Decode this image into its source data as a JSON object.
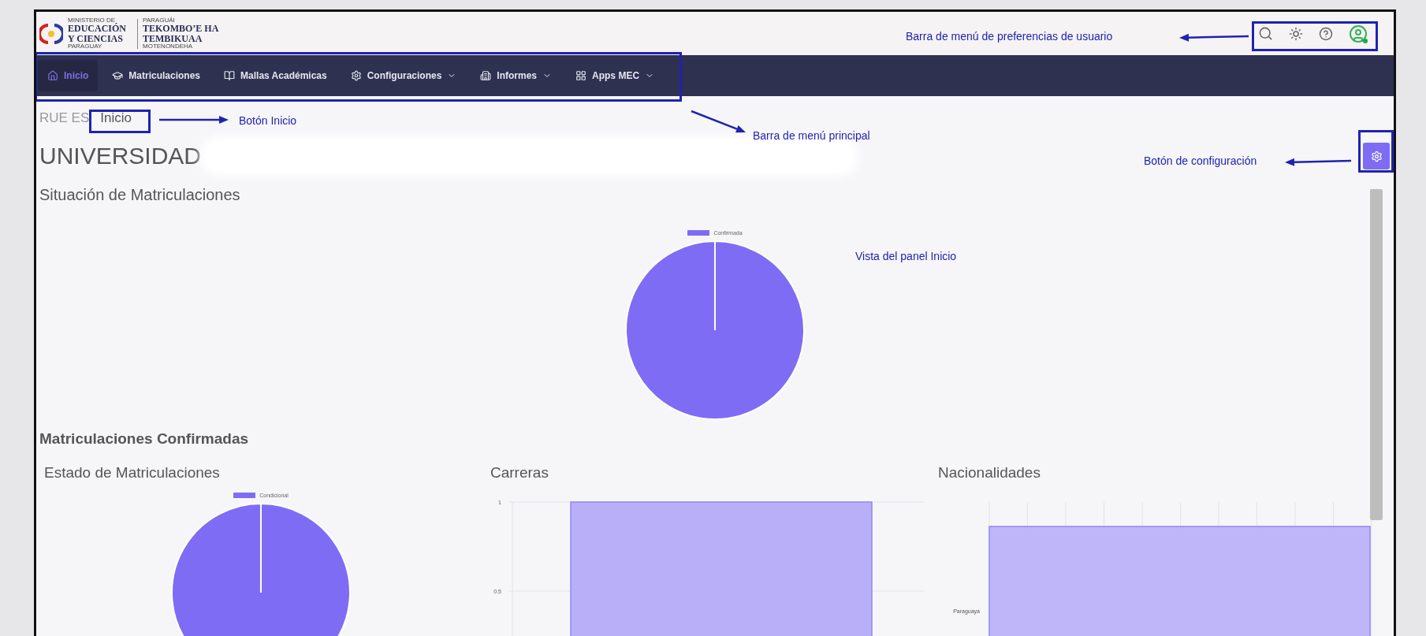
{
  "logo": {
    "ministry_top": "MINISTERIO DE",
    "ministry_name": "EDUCACIÓN Y CIENCIAS",
    "ministry_country": "PARAGUAY",
    "guarani_top": "PARAGUÁI",
    "guarani_name": "TEKOMBOʼE HA TEMBIKUAA",
    "guarani_bottom": "MOTENONDEHA"
  },
  "nav": [
    {
      "label": "Inicio",
      "selected": true,
      "dropdown": false
    },
    {
      "label": "Matriculaciones",
      "selected": false,
      "dropdown": false
    },
    {
      "label": "Mallas Académicas",
      "selected": false,
      "dropdown": false
    },
    {
      "label": "Configuraciones",
      "selected": false,
      "dropdown": true
    },
    {
      "label": "Informes",
      "selected": false,
      "dropdown": true
    },
    {
      "label": "Apps MEC",
      "selected": false,
      "dropdown": true
    }
  ],
  "breadcrumb": [
    "RUE ES",
    "Inicio"
  ],
  "title": "UNIVERSIDAD",
  "section_title": "Situación de Matriculaciones",
  "situacion_chart": {
    "legend": [
      "Confirmada"
    ]
  },
  "confirmadas_title": "Matriculaciones Confirmadas",
  "estado": {
    "title": "Estado de Matriculaciones",
    "legend": [
      "Condicional"
    ]
  },
  "carreras": {
    "title": "Carreras",
    "chart_data": {
      "type": "bar",
      "values": [
        1
      ],
      "ylim": [
        0,
        1
      ],
      "yticks": [
        0.5,
        1
      ]
    }
  },
  "nacionalidades": {
    "title": "Nacionalidades",
    "category_label": "Paraguaya"
  },
  "annotations": {
    "user_bar": "Barra de menú de preferencias de usuario",
    "home_button": "Botón Inicio",
    "main_menu": "Barra de menú principal",
    "config_button": "Botón de configuración",
    "panel_view": "Vista del panel Inicio"
  }
}
